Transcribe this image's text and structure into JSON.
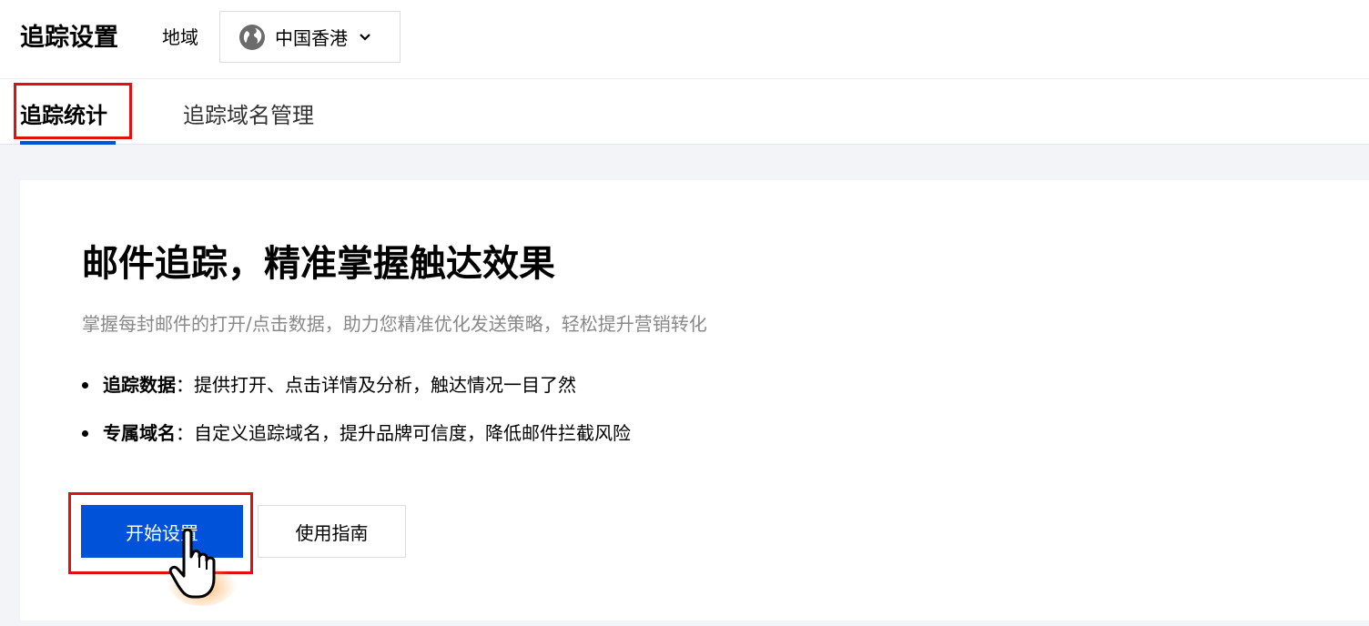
{
  "header": {
    "title": "追踪设置",
    "region_label": "地域",
    "region_value": "中国香港",
    "globe_icon": "globe-icon",
    "chevron_icon": "chevron-down-icon"
  },
  "tabs": [
    {
      "label": "追踪统计",
      "active": true
    },
    {
      "label": "追踪域名管理",
      "active": false
    }
  ],
  "main": {
    "headline": "邮件追踪，精准掌握触达效果",
    "subtitle": "掌握每封邮件的打开/点击数据，助力您精准优化发送策略，轻松提升营销转化",
    "bullets": [
      {
        "title": "追踪数据",
        "text": "：提供打开、点击详情及分析，触达情况一目了然"
      },
      {
        "title": "专属域名",
        "text": "：自定义追踪域名，提升品牌可信度，降低邮件拦截风险"
      }
    ],
    "primary_button": "开始设置",
    "secondary_button": "使用指南"
  },
  "colors": {
    "accent": "#0052d9",
    "highlight": "#e01010",
    "background": "#f3f4f7"
  },
  "cursor_icon": "hand-pointer-icon"
}
